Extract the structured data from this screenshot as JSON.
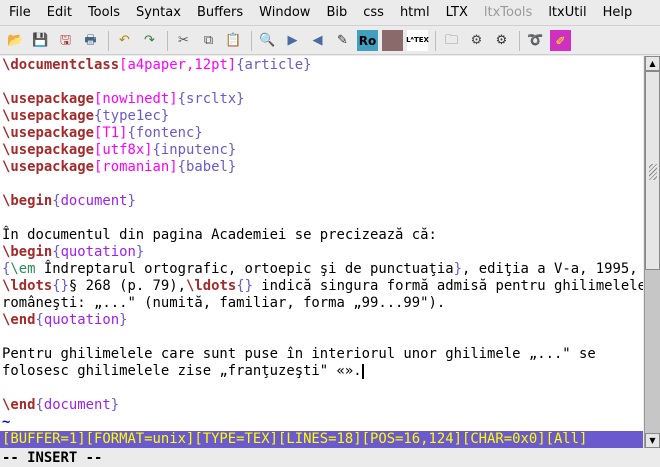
{
  "menu": [
    {
      "label": "File",
      "enabled": true
    },
    {
      "label": "Edit",
      "enabled": true
    },
    {
      "label": "Tools",
      "enabled": true
    },
    {
      "label": "Syntax",
      "enabled": true
    },
    {
      "label": "Buffers",
      "enabled": true
    },
    {
      "label": "Window",
      "enabled": true
    },
    {
      "label": "Bib",
      "enabled": true
    },
    {
      "label": "css",
      "enabled": true
    },
    {
      "label": "html",
      "enabled": true
    },
    {
      "label": "LTX",
      "enabled": true
    },
    {
      "label": "ltxTools",
      "enabled": false
    },
    {
      "label": "ltxUtil",
      "enabled": true
    },
    {
      "label": "Help",
      "enabled": true
    }
  ],
  "toolbar": [
    {
      "icon": "open-folder-icon",
      "glyph": "📂",
      "color": "#c8902a"
    },
    {
      "icon": "save-icon",
      "glyph": "💾",
      "color": "#334"
    },
    {
      "icon": "save-all-icon",
      "glyph": "🖫",
      "color": "#a33"
    },
    {
      "icon": "print-icon",
      "glyph": "🖶",
      "color": "#468"
    },
    {
      "sep": true
    },
    {
      "icon": "undo-icon",
      "glyph": "↶",
      "color": "#b8860b"
    },
    {
      "icon": "redo-icon",
      "glyph": "↷",
      "color": "#3a7a3a"
    },
    {
      "sep": true
    },
    {
      "icon": "cut-icon",
      "glyph": "✂",
      "color": "#555"
    },
    {
      "icon": "copy-icon",
      "glyph": "⧉",
      "color": "#555"
    },
    {
      "icon": "paste-icon",
      "glyph": "📋",
      "color": "#7a4a1a"
    },
    {
      "sep": true
    },
    {
      "icon": "find-icon",
      "glyph": "🔍",
      "color": "#333"
    },
    {
      "icon": "find-next-icon",
      "glyph": "▶",
      "color": "#4a6aa0"
    },
    {
      "icon": "find-prev-icon",
      "glyph": "◀",
      "color": "#4a6aa0"
    },
    {
      "icon": "spellcheck-icon",
      "glyph": "✎",
      "color": "#333"
    },
    {
      "icon": "ro-icon",
      "glyph": "Ro",
      "color": "#000",
      "bg": "#3fa0c0"
    },
    {
      "icon": "image-icon",
      "glyph": "",
      "color": "#000",
      "bg": "#8a6a6a"
    },
    {
      "icon": "latex-icon",
      "glyph": "LᴬTEX",
      "color": "#000",
      "bg": "#fff"
    },
    {
      "sep": true
    },
    {
      "icon": "folder-settings-icon",
      "glyph": "🗀",
      "color": "#666"
    },
    {
      "icon": "save-settings-icon",
      "glyph": "⚙",
      "color": "#444"
    },
    {
      "icon": "gear-icon",
      "glyph": "⚙",
      "color": "#333"
    },
    {
      "sep": true
    },
    {
      "icon": "macro-icon",
      "glyph": "➰",
      "color": "#c07000"
    },
    {
      "icon": "draw-icon",
      "glyph": "✐",
      "color": "#ff0",
      "bg": "#d030c0"
    }
  ],
  "editor": {
    "lines": [
      [
        {
          "t": "\\documentclass",
          "k": "cmd"
        },
        {
          "t": "[a4paper,12pt]",
          "k": "opt"
        },
        {
          "t": "{article}",
          "k": "arg"
        }
      ],
      [],
      [
        {
          "t": "\\usepackage",
          "k": "cmd"
        },
        {
          "t": "[nowinedt]",
          "k": "opt"
        },
        {
          "t": "{srcltx}",
          "k": "arg"
        }
      ],
      [
        {
          "t": "\\usepackage",
          "k": "cmd"
        },
        {
          "t": "{type1ec}",
          "k": "arg"
        }
      ],
      [
        {
          "t": "\\usepackage",
          "k": "cmd"
        },
        {
          "t": "[T1]",
          "k": "opt"
        },
        {
          "t": "{fontenc}",
          "k": "arg"
        }
      ],
      [
        {
          "t": "\\usepackage",
          "k": "cmd"
        },
        {
          "t": "[utf8x]",
          "k": "opt"
        },
        {
          "t": "{inputenc}",
          "k": "arg"
        }
      ],
      [
        {
          "t": "\\usepackage",
          "k": "cmd"
        },
        {
          "t": "[romanian]",
          "k": "opt"
        },
        {
          "t": "{babel}",
          "k": "arg"
        }
      ],
      [],
      [
        {
          "t": "\\begin",
          "k": "cmd"
        },
        {
          "t": "{",
          "k": "arg"
        },
        {
          "t": "document",
          "k": "env"
        },
        {
          "t": "}",
          "k": "arg"
        }
      ],
      [],
      [
        {
          "t": "În documentul din pagina Academiei se precizează că:",
          "k": "text"
        }
      ],
      [
        {
          "t": "\\begin",
          "k": "cmd"
        },
        {
          "t": "{",
          "k": "arg"
        },
        {
          "t": "quotation",
          "k": "env"
        },
        {
          "t": "}",
          "k": "arg"
        }
      ],
      [
        {
          "t": "{",
          "k": "arg"
        },
        {
          "t": "\\em",
          "k": "em"
        },
        {
          "t": " Îndreptarul ortografic, ortoepic şi de punctuaţia",
          "k": "text"
        },
        {
          "t": "}",
          "k": "arg"
        },
        {
          "t": ", ediţia a V-a, 1995,",
          "k": "text"
        }
      ],
      [
        {
          "t": "\\ldots",
          "k": "cmd"
        },
        {
          "t": "{}",
          "k": "arg"
        },
        {
          "t": "§ 268 (p. 79),",
          "k": "text"
        },
        {
          "t": "\\ldots",
          "k": "cmd"
        },
        {
          "t": "{}",
          "k": "arg"
        },
        {
          "t": " indică singura formă admisă pentru ghilimelele",
          "k": "text"
        }
      ],
      [
        {
          "t": "româneşti: „...\" (numită, familiar, forma „99...99\").",
          "k": "text"
        }
      ],
      [
        {
          "t": "\\end",
          "k": "cmd"
        },
        {
          "t": "{",
          "k": "arg"
        },
        {
          "t": "quotation",
          "k": "env"
        },
        {
          "t": "}",
          "k": "arg"
        }
      ],
      [],
      [
        {
          "t": "Pentru ghilimelele care sunt puse în interiorul unor ghilimele „...\" se",
          "k": "text"
        }
      ],
      [
        {
          "t": "folosesc ghilimelele zise „franţuzeşti\" «».",
          "k": "text"
        },
        {
          "t": "",
          "k": "cursor"
        }
      ],
      [],
      [
        {
          "t": "\\end",
          "k": "cmd"
        },
        {
          "t": "{",
          "k": "arg"
        },
        {
          "t": "document",
          "k": "env"
        },
        {
          "t": "}",
          "k": "arg"
        }
      ],
      [
        {
          "t": "~",
          "k": "tilde"
        }
      ]
    ]
  },
  "statusline": "[BUFFER=1][FORMAT=unix][TYPE=TEX][LINES=18][POS=16,124][CHAR=0x0][All]",
  "mode": "-- INSERT --",
  "scroll": {
    "position_fraction": 0.0,
    "visible_fraction": 0.55
  }
}
